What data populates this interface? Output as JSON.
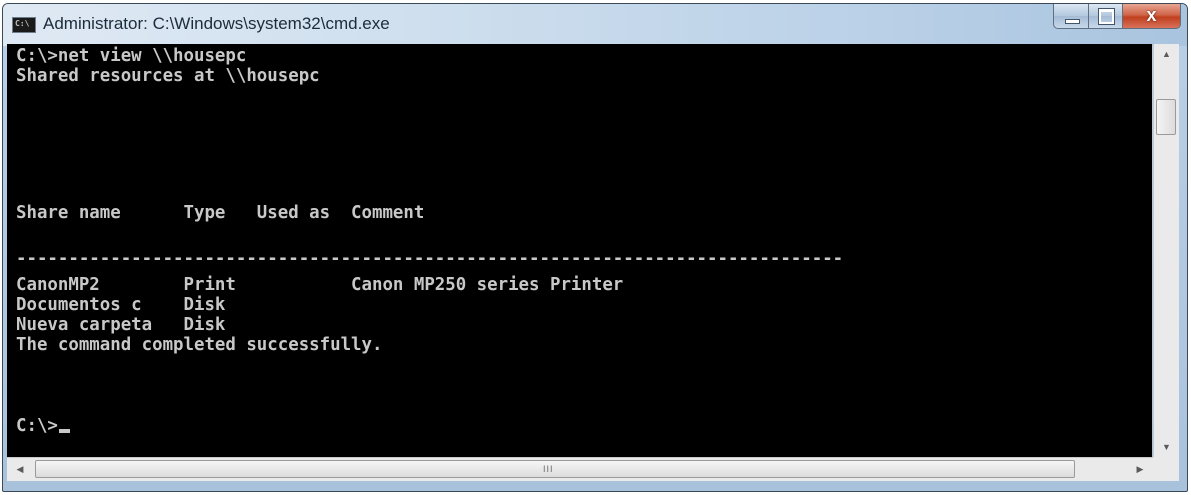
{
  "window": {
    "title": "Administrator: C:\\Windows\\system32\\cmd.exe",
    "icon_text": "C:\\",
    "icon": "cmd-icon",
    "minimize_icon": "minimize-icon",
    "maximize_icon": "maximize-icon",
    "close_icon": "close-icon",
    "close_glyph": "x"
  },
  "console": {
    "lines": [
      "C:\\>net view \\\\housepc",
      "Shared resources at \\\\housepc",
      "",
      "",
      "",
      "Share name      Type   Used as  Comment",
      "",
      "-------------------------------------------------------------------------------",
      "CanonMP2        Print           Canon MP250 series Printer",
      "Documentos c    Disk",
      "Nueva carpeta   Disk",
      "The command completed successfully.",
      "",
      "",
      "C:\\>"
    ]
  },
  "scrollbars": {
    "up_arrow": "▲",
    "down_arrow": "▼",
    "left_arrow": "◀",
    "right_arrow": "▶",
    "grip": "III"
  },
  "colors": {
    "console_bg": "#000000",
    "console_text": "#c8c8c8",
    "close_button": "#c7462a"
  }
}
